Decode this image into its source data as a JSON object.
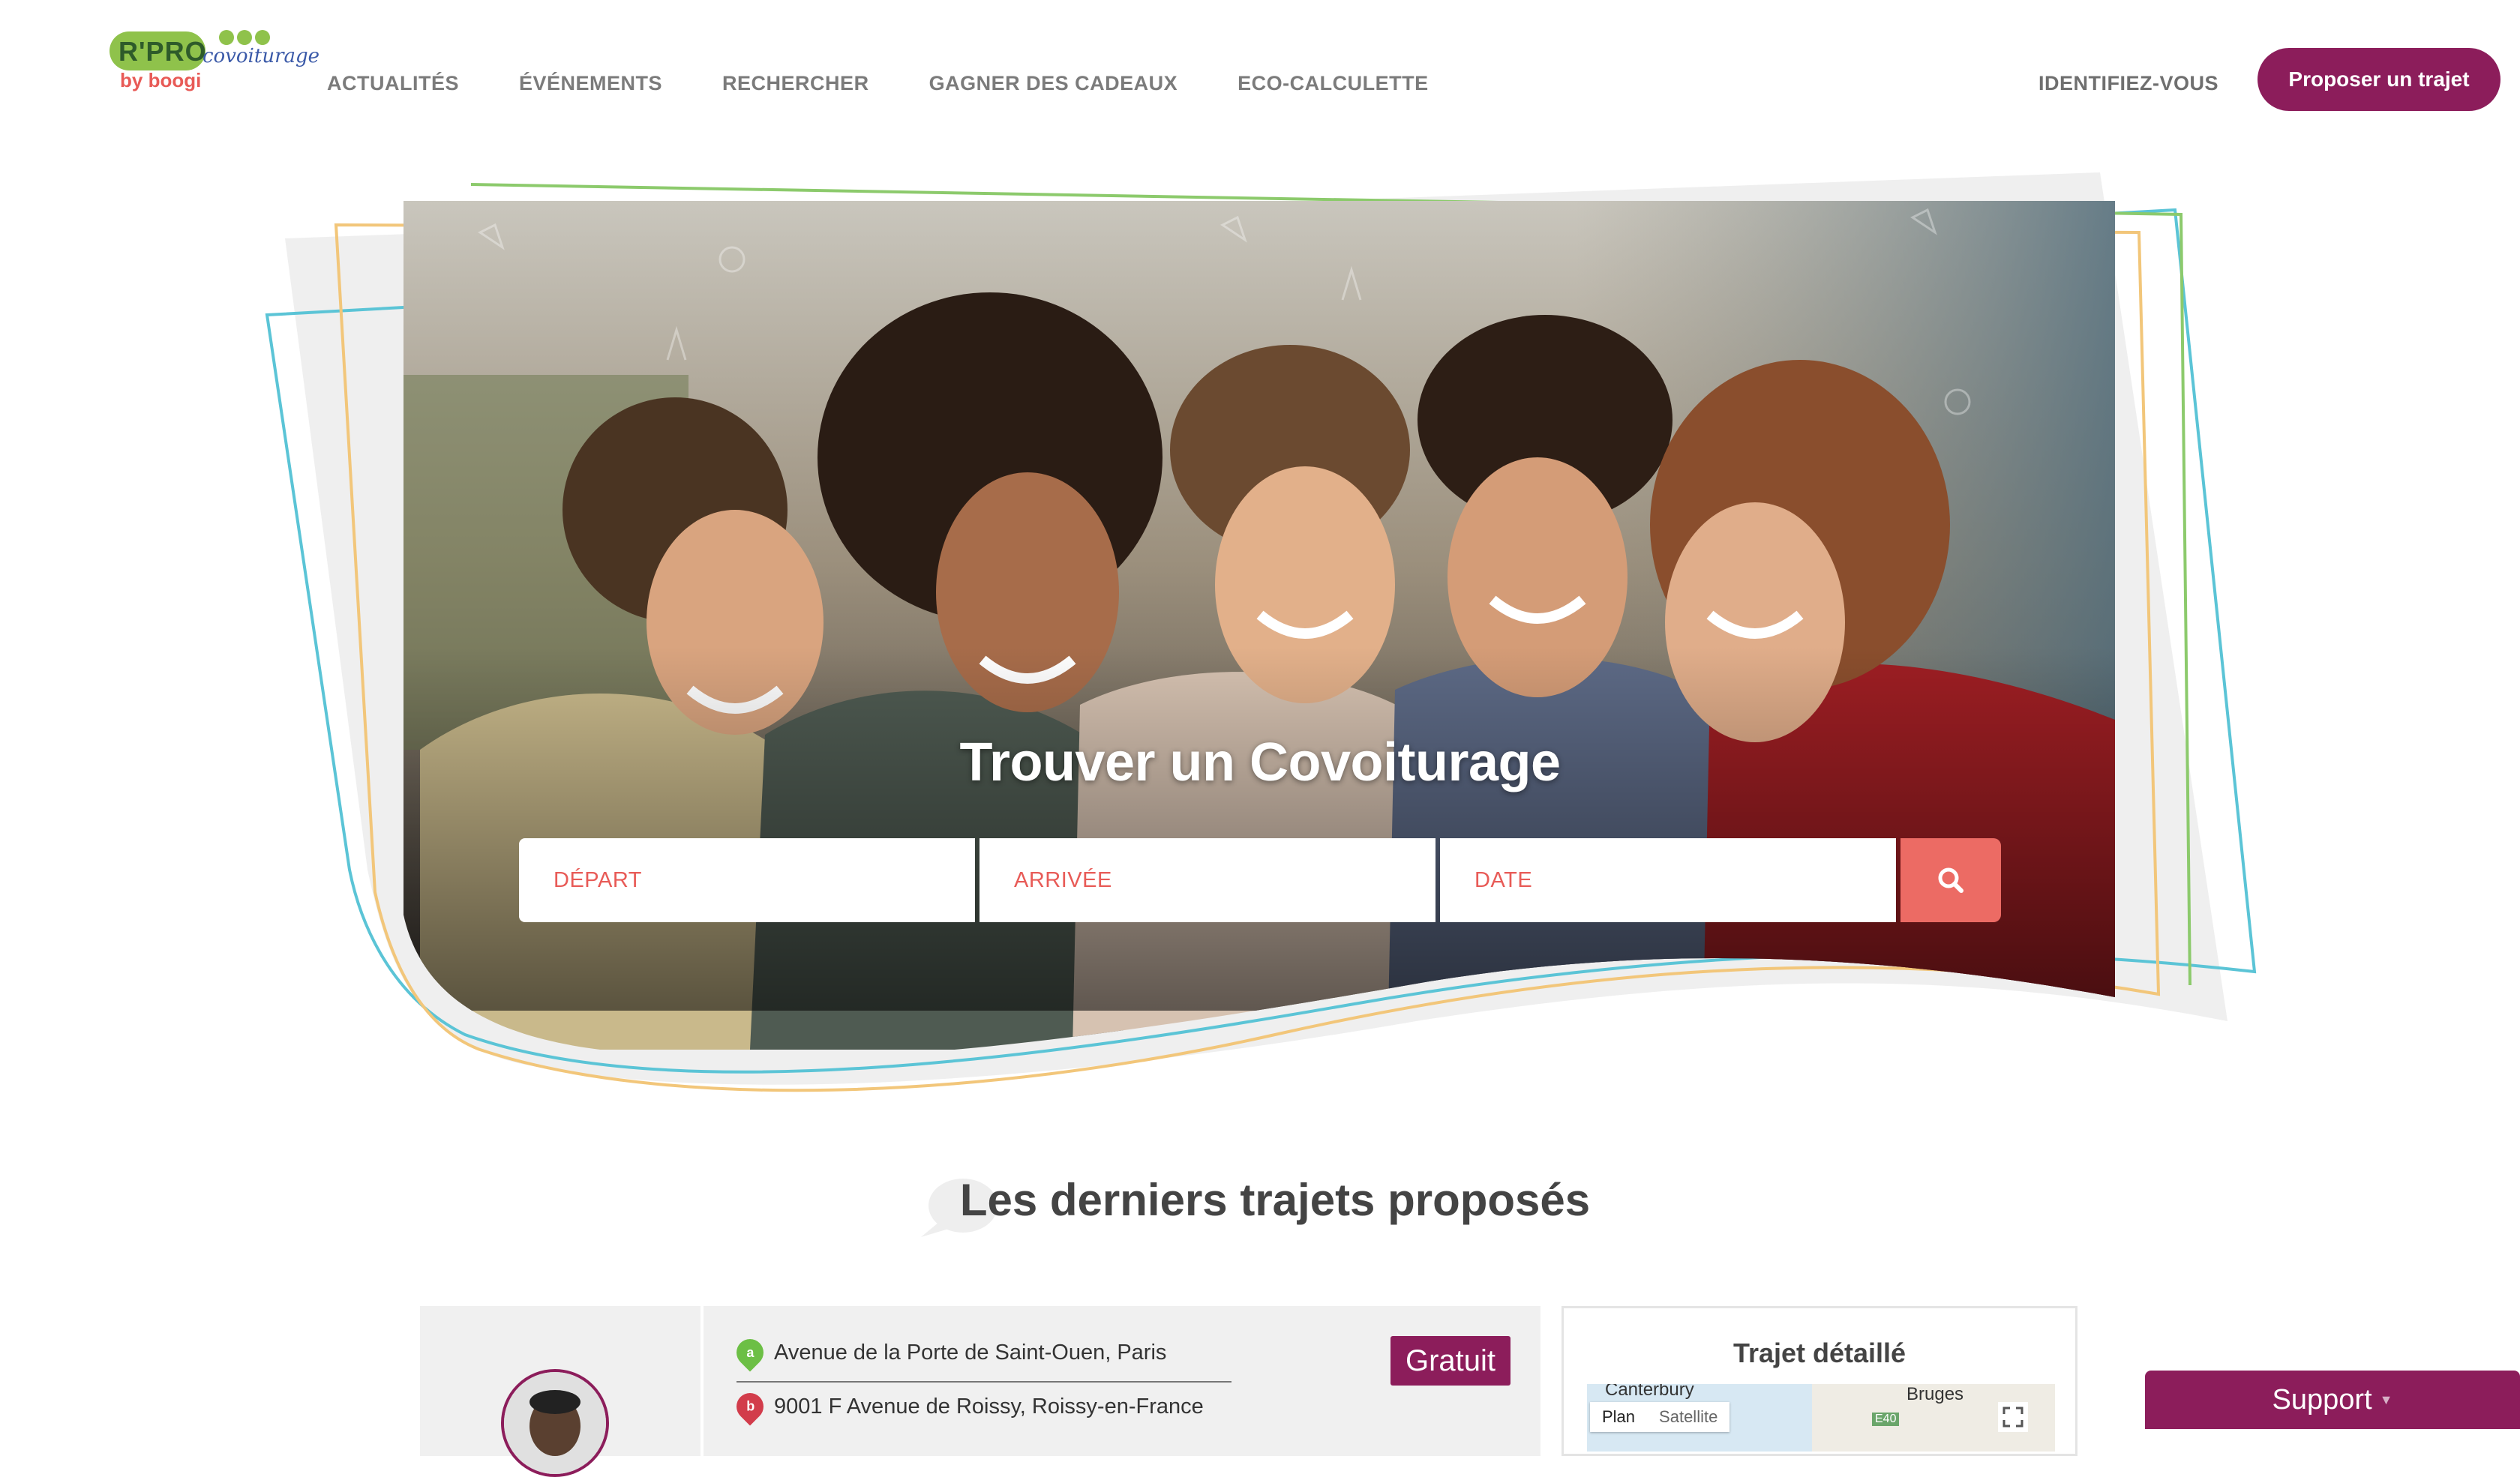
{
  "brand": {
    "logo_main": "R'PRO",
    "logo_script": "covoiturage",
    "logo_by": "by boogi"
  },
  "nav": {
    "items": [
      {
        "label": "ACTUALITÉS"
      },
      {
        "label": "ÉVÉNEMENTS"
      },
      {
        "label": "RECHERCHER"
      },
      {
        "label": "GAGNER DES CADEAUX"
      },
      {
        "label": "ECO-CALCULETTE"
      }
    ],
    "login": "IDENTIFIEZ-VOUS",
    "cta": "Proposer un trajet"
  },
  "hero": {
    "title": "Trouver un Covoiturage",
    "search": {
      "depart_placeholder": "DÉPART",
      "arrivee_placeholder": "ARRIVÉE",
      "date_placeholder": "DATE",
      "button_icon": "search-icon"
    }
  },
  "section": {
    "title": "Les derniers trajets proposés"
  },
  "trip": {
    "from_marker": "a",
    "from": "Avenue de la Porte de Saint-Ouen, Paris",
    "to_marker": "b",
    "to": "9001 F Avenue de Roissy, Roissy-en-France",
    "price_badge": "Gratuit"
  },
  "detail": {
    "title": "Trajet détaillé",
    "map_labels": {
      "city_1": "Canterbury",
      "city_2": "Bruges",
      "road": "E40"
    },
    "map_tabs": [
      "Plan",
      "Satellite"
    ]
  },
  "support": {
    "label": "Support"
  },
  "colors": {
    "brand_primary": "#8c1d5b",
    "accent": "#e85b57",
    "logo_green": "#8fc24b"
  }
}
